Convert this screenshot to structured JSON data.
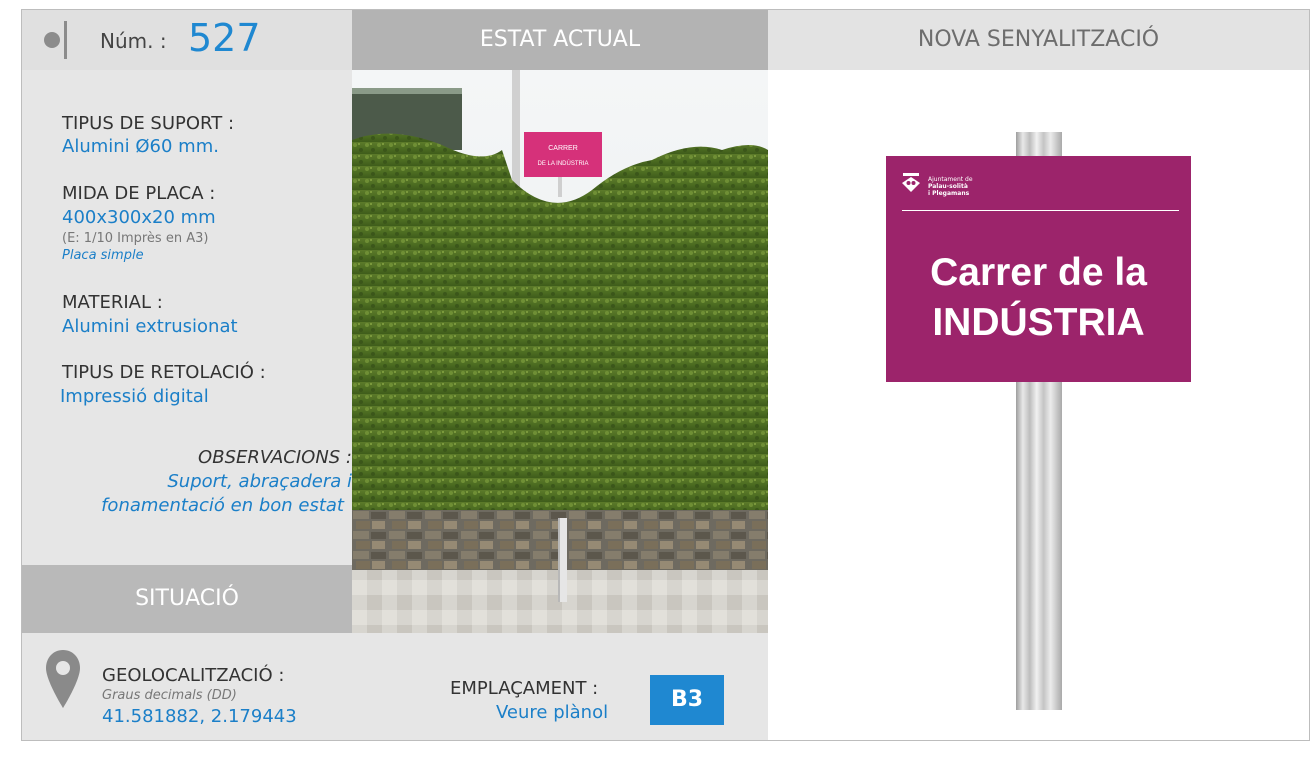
{
  "header": {
    "num_label": "Núm. :",
    "num_value": "527",
    "estat_title": "ESTAT ACTUAL",
    "nova_title": "NOVA SENYALITZACIÓ"
  },
  "info": {
    "suport_label": "TIPUS DE SUPORT :",
    "suport_value": "Alumini Ø60 mm.",
    "mida_label": "MIDA DE PLACA :",
    "mida_value": "400x300x20 mm",
    "mida_scale": "(E: 1/10 Imprès en A3)",
    "mida_type": "Placa simple",
    "material_label": "MATERIAL :",
    "material_value": "Alumini extrusionat",
    "retolacio_label": "TIPUS DE RETOLACIÓ :",
    "retolacio_value": "Impressió digital",
    "obs_label": "OBSERVACIONS :",
    "obs_line1": "Suport, abraçadera i",
    "obs_line2": "fonamentació en bon estat"
  },
  "situacio": {
    "title": "SITUACIÓ",
    "geo_label": "GEOLOCALITZACIÓ :",
    "geo_format": "Graus decimals (DD)",
    "geo_value": "41.581882, 2.179443",
    "empl_label": "EMPLAÇAMENT :",
    "empl_value": "Veure plànol",
    "empl_code": "B3"
  },
  "photo": {
    "sign_line1": "CARRER",
    "sign_line2": "DE LA INDÚSTRIA"
  },
  "plate": {
    "org_line1": "Ajuntament de",
    "org_line2": "Palau-solità",
    "org_line3": "i Plegamans",
    "title_line1": "Carrer de la",
    "title_line2": "INDÚSTRIA"
  },
  "colors": {
    "accent_blue": "#1f88d1",
    "plate_magenta": "#9c246b",
    "header_gray": "#b3b3b3"
  },
  "icons": [
    "location-pin-icon",
    "municipal-shield-icon"
  ]
}
